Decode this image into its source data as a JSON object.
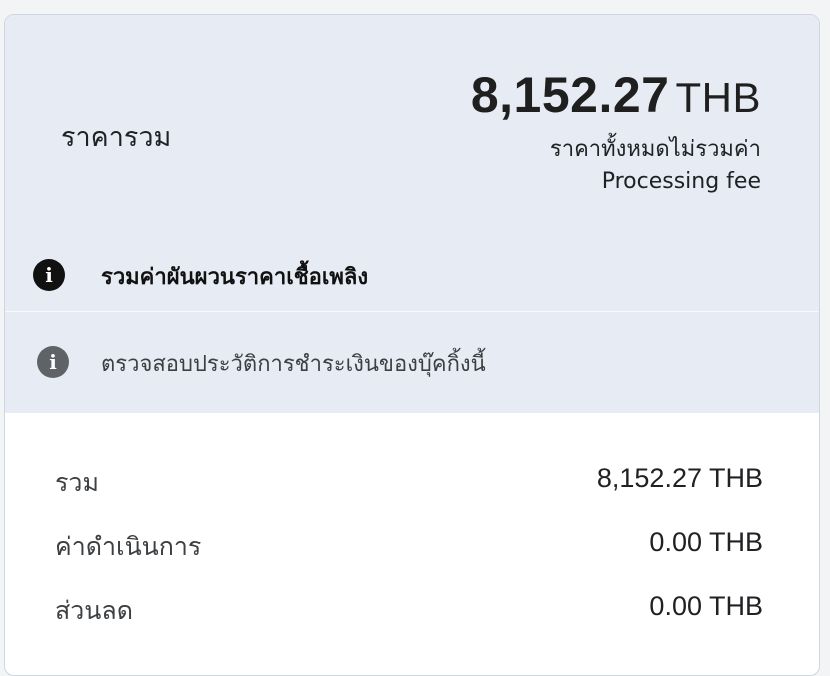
{
  "summary": {
    "total_label": "ราคารวม",
    "total_amount": "8,152.27",
    "currency": "THB",
    "note_line1": "ราคาทั้งหมดไม่รวมค่า",
    "note_line2": "Processing fee"
  },
  "fuel_notice": {
    "icon": "info-icon",
    "text": "รวมค่าผันผวนราคาเชื้อเพลิง"
  },
  "history_link": {
    "icon": "info-icon",
    "text": "ตรวจสอบประวัติการชำระเงินของบุ๊คกิ้งนี้"
  },
  "breakdown": [
    {
      "label": "รวม",
      "value": "8,152.27 THB"
    },
    {
      "label": "ค่าดำเนินการ",
      "value": "0.00 THB"
    },
    {
      "label": "ส่วนลด",
      "value": "0.00 THB"
    }
  ],
  "colors": {
    "summary_background": "#e7ecf4",
    "card_border": "#cfd6e0",
    "fuel_icon": "#111111",
    "history_icon": "#5f6368"
  }
}
